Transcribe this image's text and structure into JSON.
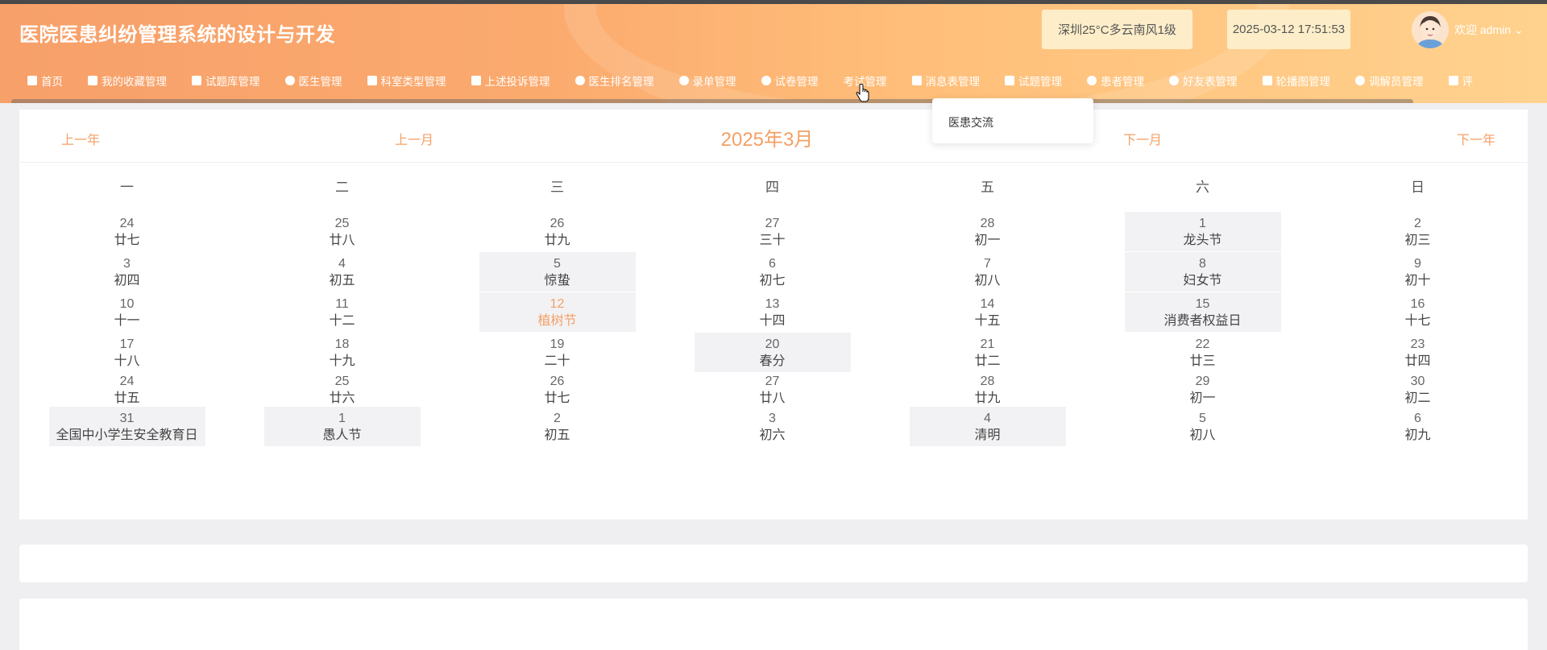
{
  "app": {
    "title": "医院医患纠纷管理系统的设计与开发",
    "weather": "深圳25°C多云南风1级",
    "datetime": "2025-03-12 17:51:53",
    "welcome": "欢迎 admin"
  },
  "nav": [
    {
      "label": "首页",
      "icon": "home-icon"
    },
    {
      "label": "我的收藏管理",
      "icon": "home-icon"
    },
    {
      "label": "试题库管理",
      "icon": "stack-icon"
    },
    {
      "label": "医生管理",
      "icon": "user-icon"
    },
    {
      "label": "科室类型管理",
      "icon": "list-icon"
    },
    {
      "label": "上述投诉管理",
      "icon": "list-icon"
    },
    {
      "label": "医生排名管理",
      "icon": "circle-icon"
    },
    {
      "label": "录单管理",
      "icon": "circle-icon"
    },
    {
      "label": "试卷管理",
      "icon": "circle-icon"
    },
    {
      "label": "考试管理",
      "icon": ""
    },
    {
      "label": "消息表管理",
      "icon": "list-icon"
    },
    {
      "label": "试题管理",
      "icon": "grid-icon"
    },
    {
      "label": "患者管理",
      "icon": "user-icon"
    },
    {
      "label": "好友表管理",
      "icon": "circle-icon"
    },
    {
      "label": "轮播图管理",
      "icon": "grid-icon"
    },
    {
      "label": "调解员管理",
      "icon": "circle-icon"
    },
    {
      "label": "评",
      "icon": "home-icon"
    }
  ],
  "dropdown": {
    "item": "医患交流"
  },
  "calendar": {
    "prev_year": "上一年",
    "prev_month": "上一月",
    "title": "2025年3月",
    "next_month": "下一月",
    "next_year": "下一年",
    "weekdays": [
      "一",
      "二",
      "三",
      "四",
      "五",
      "六",
      "日"
    ],
    "weeks": [
      [
        {
          "d": "24",
          "l": "廿七"
        },
        {
          "d": "25",
          "l": "廿八"
        },
        {
          "d": "26",
          "l": "廿九"
        },
        {
          "d": "27",
          "l": "三十"
        },
        {
          "d": "28",
          "l": "初一"
        },
        {
          "d": "1",
          "l": "龙头节",
          "hl": true
        },
        {
          "d": "2",
          "l": "初三"
        }
      ],
      [
        {
          "d": "3",
          "l": "初四"
        },
        {
          "d": "4",
          "l": "初五"
        },
        {
          "d": "5",
          "l": "惊蛰",
          "hl": true
        },
        {
          "d": "6",
          "l": "初七"
        },
        {
          "d": "7",
          "l": "初八"
        },
        {
          "d": "8",
          "l": "妇女节",
          "hl": true
        },
        {
          "d": "9",
          "l": "初十"
        }
      ],
      [
        {
          "d": "10",
          "l": "十一"
        },
        {
          "d": "11",
          "l": "十二"
        },
        {
          "d": "12",
          "l": "植树节",
          "hl": true,
          "today": true
        },
        {
          "d": "13",
          "l": "十四"
        },
        {
          "d": "14",
          "l": "十五"
        },
        {
          "d": "15",
          "l": "消费者权益日",
          "hl": true
        },
        {
          "d": "16",
          "l": "十七"
        }
      ],
      [
        {
          "d": "17",
          "l": "十八"
        },
        {
          "d": "18",
          "l": "十九"
        },
        {
          "d": "19",
          "l": "二十"
        },
        {
          "d": "20",
          "l": "春分",
          "hl": true
        },
        {
          "d": "21",
          "l": "廿二"
        },
        {
          "d": "22",
          "l": "廿三"
        },
        {
          "d": "23",
          "l": "廿四"
        }
      ],
      [
        {
          "d": "24",
          "l": "廿五"
        },
        {
          "d": "25",
          "l": "廿六"
        },
        {
          "d": "26",
          "l": "廿七"
        },
        {
          "d": "27",
          "l": "廿八"
        },
        {
          "d": "28",
          "l": "廿九"
        },
        {
          "d": "29",
          "l": "初一"
        },
        {
          "d": "30",
          "l": "初二"
        }
      ],
      [
        {
          "d": "31",
          "l": "全国中小学生安全教育日",
          "hl": true
        },
        {
          "d": "1",
          "l": "愚人节",
          "hl": true
        },
        {
          "d": "2",
          "l": "初五"
        },
        {
          "d": "3",
          "l": "初六"
        },
        {
          "d": "4",
          "l": "清明",
          "hl": true
        },
        {
          "d": "5",
          "l": "初八"
        },
        {
          "d": "6",
          "l": "初九"
        }
      ]
    ]
  }
}
